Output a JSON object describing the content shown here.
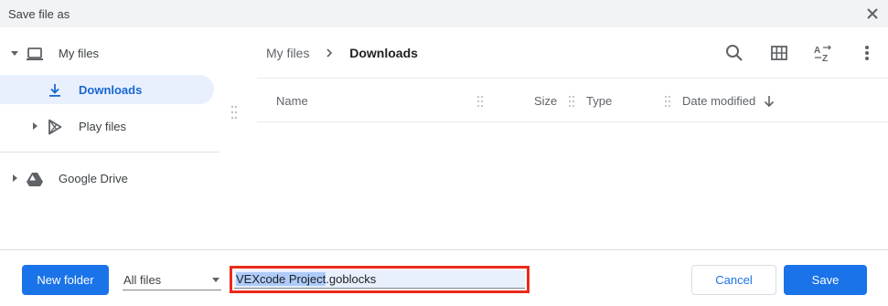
{
  "window": {
    "title": "Save file as"
  },
  "sidebar": {
    "items": [
      {
        "label": "My files",
        "icon": "laptop-icon",
        "expanded": true
      },
      {
        "label": "Downloads",
        "icon": "download-icon",
        "selected": true
      },
      {
        "label": "Play files",
        "icon": "play-store-icon",
        "expanded": false
      },
      {
        "label": "Google Drive",
        "icon": "google-drive-icon",
        "expanded": false
      }
    ]
  },
  "breadcrumb": {
    "root": "My files",
    "current": "Downloads"
  },
  "toolbar": {
    "icons": [
      "search-icon",
      "grid-view-icon",
      "sort-az-icon",
      "more-vert-icon"
    ]
  },
  "columns": {
    "name": "Name",
    "size": "Size",
    "type": "Type",
    "date": "Date modified"
  },
  "footer": {
    "new_folder": "New folder",
    "filter": "All files",
    "filename_selected": "VEXcode Project",
    "filename_ext": ".goblocks",
    "cancel": "Cancel",
    "save": "Save"
  },
  "colors": {
    "accent": "#1a73e8",
    "selection_bg": "#e8f0fe",
    "highlight_border": "#ea2a1a"
  }
}
